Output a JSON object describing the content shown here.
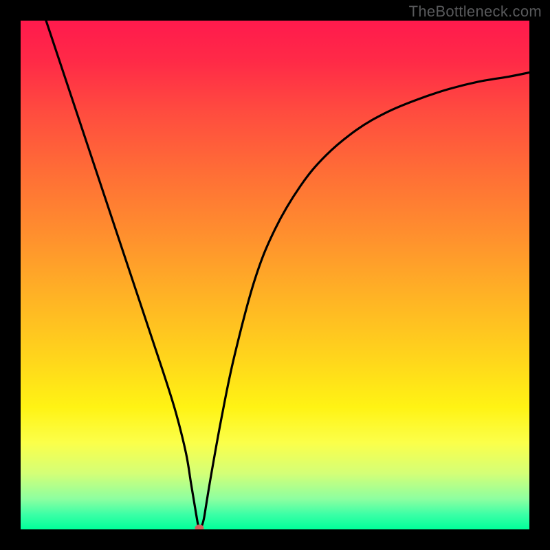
{
  "watermark": "TheBottleneck.com",
  "chart_data": {
    "type": "line",
    "title": "",
    "xlabel": "",
    "ylabel": "",
    "xlim": [
      0,
      100
    ],
    "ylim": [
      0,
      100
    ],
    "grid": false,
    "series": [
      {
        "name": "bottleneck-curve",
        "x": [
          5,
          10,
          15,
          20,
          24,
          28,
          30.5,
          32.5,
          33.5,
          34.5,
          35,
          35.5,
          36,
          36.5,
          37.5,
          39.5,
          42,
          46,
          50,
          55,
          60,
          66,
          72,
          78,
          84,
          90,
          96,
          100
        ],
        "y": [
          100,
          85,
          70,
          55,
          43,
          31,
          23,
          15,
          9,
          3,
          0.5,
          0.5,
          2,
          5,
          11,
          22,
          34,
          49,
          59,
          67.5,
          73.5,
          78.5,
          82,
          84.5,
          86.5,
          88,
          89,
          89.8
        ]
      }
    ],
    "marker": {
      "x": 35.2,
      "y": 0.3,
      "color": "#d25f5b"
    },
    "gradient_stops": [
      {
        "pos": 0,
        "color": "#ff1a4d"
      },
      {
        "pos": 50,
        "color": "#ffb225"
      },
      {
        "pos": 78,
        "color": "#fff314"
      },
      {
        "pos": 100,
        "color": "#00ff9a"
      }
    ]
  }
}
